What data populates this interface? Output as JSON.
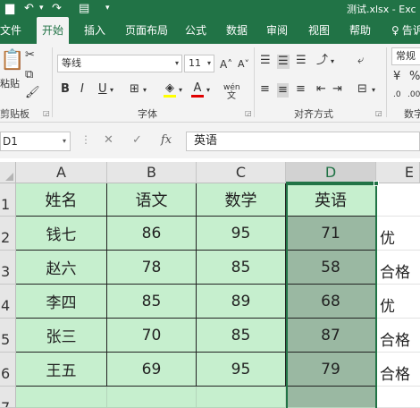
{
  "titlebar": {
    "title": "测试.xlsx - Exc",
    "undo_icon": "undo-icon",
    "redo_icon": "redo-icon",
    "form_icon": "form-icon",
    "customize_icon": "customize-qat-icon"
  },
  "tabs": [
    "文件",
    "开始",
    "插入",
    "页面布局",
    "公式",
    "数据",
    "审阅",
    "视图",
    "帮助",
    "告诉"
  ],
  "active_tab": "开始",
  "ribbon": {
    "clipboard": {
      "paste_label": "粘贴",
      "group_label": "剪贴板"
    },
    "font": {
      "name": "等线",
      "size": "11",
      "group_label": "字体",
      "grow": "A",
      "shrink": "A",
      "bold": "B",
      "italic": "I",
      "underline": "U",
      "font_color": "A",
      "phonetic": "wén"
    },
    "alignment": {
      "group_label": "对齐方式"
    },
    "number": {
      "format": "常规",
      "group_label": "数字"
    }
  },
  "formula_bar": {
    "name_box": "D1",
    "fx": "fx",
    "value": "英语"
  },
  "grid": {
    "columns": [
      "A",
      "B",
      "C",
      "D",
      "E"
    ],
    "rows": [
      "1",
      "2",
      "3",
      "4",
      "5",
      "6",
      "7"
    ],
    "header": [
      "姓名",
      "语文",
      "数学",
      "英语"
    ],
    "data": [
      [
        "钱七",
        "86",
        "95",
        "71"
      ],
      [
        "赵六",
        "78",
        "85",
        "58"
      ],
      [
        "李四",
        "85",
        "89",
        "68"
      ],
      [
        "张三",
        "70",
        "85",
        "87"
      ],
      [
        "王五",
        "69",
        "95",
        "79"
      ]
    ],
    "col_e": [
      "",
      "优",
      "合格",
      "优",
      "合格",
      "合格",
      ""
    ],
    "selected_column": "D"
  },
  "colors": {
    "excel_green": "#217346",
    "cell_fill": "#c6efce",
    "selected_fill": "#9ab8a2"
  }
}
